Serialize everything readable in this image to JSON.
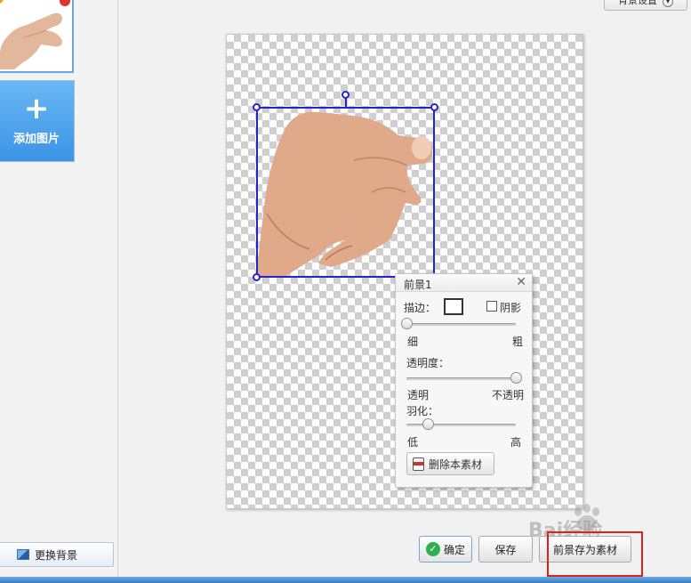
{
  "left_panel": {
    "add_image_icon": "plus-icon",
    "add_image_label": "添加图片",
    "change_bg_label": "更换背景",
    "change_bg_icon": "image-icon"
  },
  "top_right": {
    "bg_settings_label": "背景设置"
  },
  "fg_panel": {
    "title": "前景1",
    "stroke_label": "描边：",
    "shadow_label": "阴影",
    "shadow_checked": false,
    "thin_label": "细",
    "thick_label": "粗",
    "stroke_value": 0,
    "opacity_label": "透明度：",
    "transparent_label": "透明",
    "opaque_label": "不透明",
    "opacity_value": 1.0,
    "feather_label": "羽化：",
    "low_label": "低",
    "high_label": "高",
    "feather_value": 0.2,
    "delete_label": "删除本素材"
  },
  "actions": {
    "ok_label": "确定",
    "save_label": "保存",
    "save_material_label": "前景存为素材"
  },
  "watermark": {
    "text": "Bai经验"
  },
  "colors": {
    "selection": "#2424c8",
    "highlight_box": "#e02020",
    "accent_blue": "#3c94e6"
  }
}
